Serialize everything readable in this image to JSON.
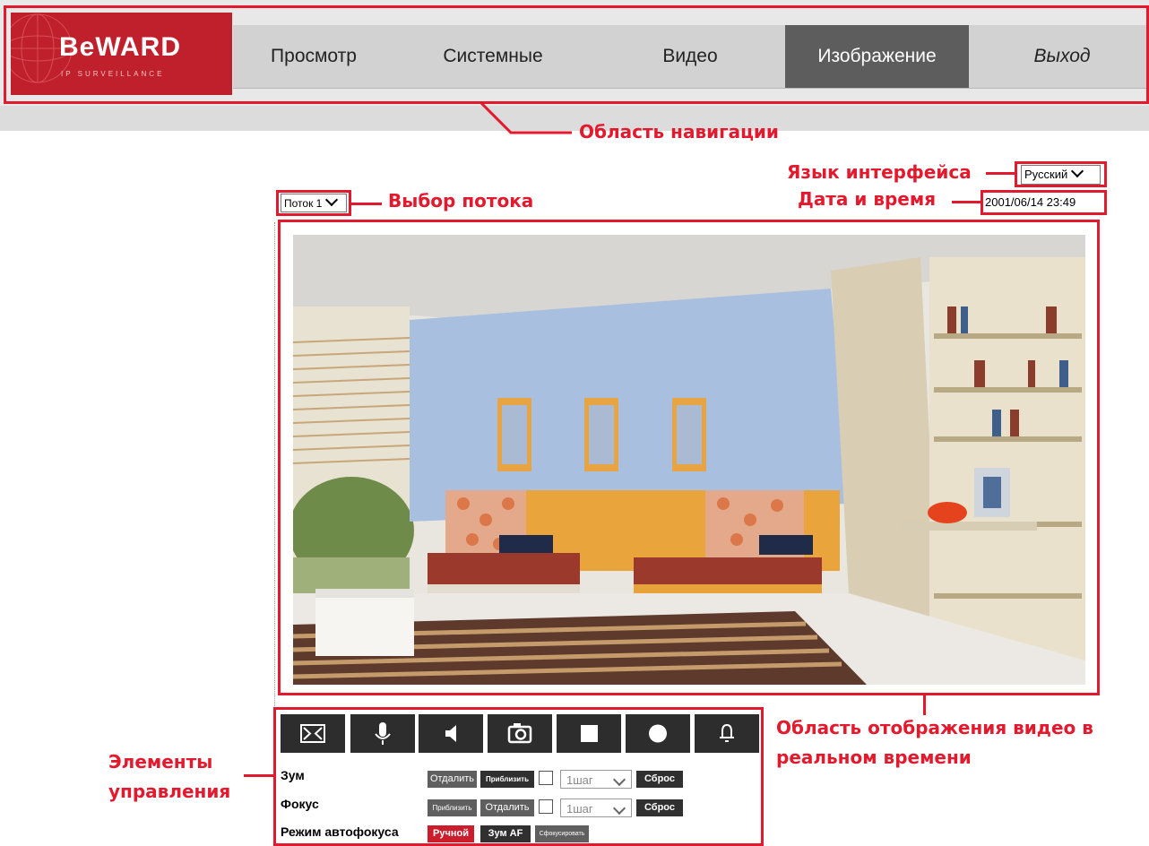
{
  "brand": {
    "logo_text": "BeWARD",
    "logo_subtext": "IP SURVEILLANCE"
  },
  "nav": {
    "items": [
      {
        "label": "Просмотр"
      },
      {
        "label": "Системные"
      },
      {
        "label": "Видео"
      },
      {
        "label": "Изображение",
        "active": true
      },
      {
        "label": "Выход"
      }
    ]
  },
  "stream_select": {
    "value": "Поток 1"
  },
  "language_select": {
    "value": "Русский"
  },
  "datetime": "2001/06/14 23:49",
  "video": {
    "scene": "live camera view of a furnished room"
  },
  "controls": {
    "buttons": [
      {
        "icon": "fullscreen-icon"
      },
      {
        "icon": "microphone-icon"
      },
      {
        "icon": "speaker-icon"
      },
      {
        "icon": "camera-snapshot-icon"
      },
      {
        "icon": "stop-icon"
      },
      {
        "icon": "record-icon"
      },
      {
        "icon": "alarm-bell-icon"
      }
    ],
    "zoom": {
      "label": "Зум",
      "zoom_out": "Отдалить",
      "zoom_in": "Приблизить",
      "step": "1шаг",
      "reset": "Сброс"
    },
    "focus": {
      "label": "Фокус",
      "near": "Приблизить",
      "far": "Отдалить",
      "step": "1шаг",
      "reset": "Сброс"
    },
    "autofocus": {
      "label": "Режим автофокуса",
      "manual": "Ручной",
      "zoom_af": "Зум AF",
      "focus_now": "Сфокусировать"
    }
  },
  "annotations": {
    "navigation": "Область навигации",
    "language": "Язык интерфейса",
    "datetime": "Дата и время",
    "stream": "Выбор потока",
    "video_line1": "Область отображения видео в",
    "video_line2": "реальном времени",
    "controls_line1": "Элементы",
    "controls_line2": "управления"
  },
  "colors": {
    "accent": "#e3192d",
    "logo_bg": "#c0202b",
    "nav_active": "#5d5d5d",
    "control_bg": "#2d2d2d"
  }
}
